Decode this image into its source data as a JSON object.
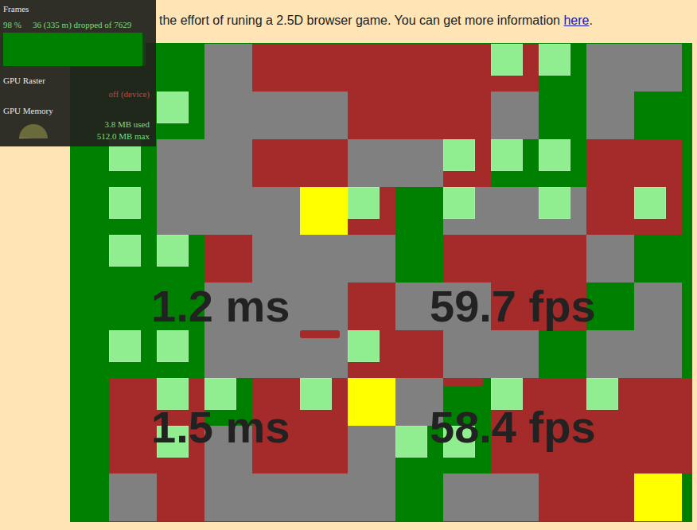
{
  "intro": {
    "text": "the effort of runing a 2.5D browser game. You can get more information ",
    "link": "here",
    "suffix": "."
  },
  "perf_panel": {
    "title": "Frames",
    "percent": "98 %",
    "dropped": "36 (335 m) dropped of 7629",
    "frame_level": 0.98,
    "raster_label": "GPU Raster",
    "raster_value": "off (device)",
    "memory_label": "GPU Memory",
    "memory_used": "3.8 MB used",
    "memory_max": "512.0 MB max",
    "memory_level": 0.0074
  },
  "stats": [
    {
      "time": "1.2 ms",
      "fps": "59.7 fps"
    },
    {
      "time": "1.5 ms",
      "fps": "58.4 fps"
    }
  ],
  "sprites": [
    {
      "col": 5,
      "row": 6
    },
    {
      "col": 7,
      "row": 6
    },
    {
      "col": 8,
      "row": 7
    }
  ],
  "map": [
    [
      "grass",
      "grass",
      "grass",
      "stone",
      "wall",
      "wall",
      "wall",
      "wall",
      "wall",
      "wall-gem",
      "grass-gem",
      "stone",
      "stone",
      "grass"
    ],
    [
      "grass",
      "grass",
      "grass-gem",
      "stone",
      "stone",
      "stone",
      "wall",
      "wall",
      "wall",
      "stone",
      "grass",
      "stone",
      "grass",
      "grass"
    ],
    [
      "grass",
      "grass-gem",
      "stone",
      "stone",
      "wall",
      "wall",
      "stone",
      "stone",
      "wall-gem",
      "grass-gem",
      "grass-gem",
      "wall",
      "wall",
      "grass"
    ],
    [
      "grass",
      "grass-gem",
      "stone",
      "stone",
      "stone",
      "gold",
      "wall-gem",
      "grass",
      "stone-gem",
      "stone",
      "stone-gem",
      "wall",
      "wall-gem",
      "grass"
    ],
    [
      "grass",
      "grass-gem",
      "grass-gem",
      "wall",
      "stone",
      "stone",
      "stone",
      "grass",
      "wall",
      "wall",
      "wall",
      "stone",
      "grass",
      "grass"
    ],
    [
      "grass",
      "grass",
      "grass",
      "stone",
      "stone",
      "stone",
      "wall",
      "stone",
      "stone",
      "wall",
      "wall",
      "grass",
      "stone",
      "grass"
    ],
    [
      "grass",
      "grass-gem",
      "grass-gem",
      "stone",
      "stone",
      "stone",
      "wall-gem",
      "wall",
      "stone",
      "stone",
      "grass",
      "stone",
      "stone",
      "grass"
    ],
    [
      "grass",
      "wall",
      "wall-gem",
      "grass-gem",
      "wall",
      "wall-gem",
      "gold",
      "stone",
      "grass",
      "wall-gem",
      "wall",
      "wall-gem",
      "wall",
      "wall"
    ],
    [
      "grass",
      "wall",
      "wall-gem",
      "stone",
      "wall",
      "wall",
      "stone",
      "grass-gem",
      "grass-gem",
      "wall",
      "wall",
      "wall",
      "wall",
      "wall"
    ],
    [
      "grass",
      "stone",
      "wall",
      "stone",
      "stone",
      "stone",
      "stone",
      "grass",
      "stone",
      "stone",
      "wall",
      "wall",
      "gold",
      "grass"
    ]
  ]
}
